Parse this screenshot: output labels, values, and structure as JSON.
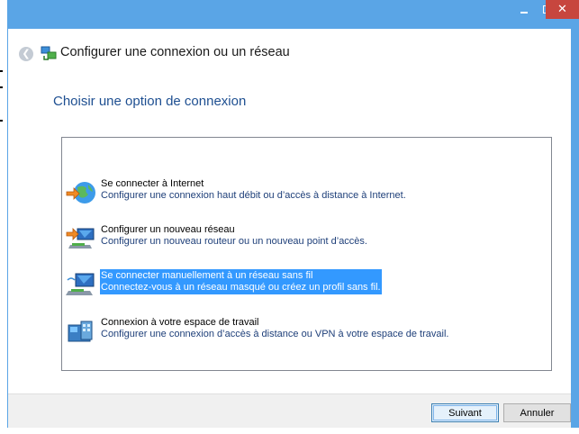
{
  "window": {
    "title": "Configurer une connexion ou un réseau",
    "controls": {
      "minimize_icon": "minimize-icon",
      "maximize_icon": "maximize-icon",
      "close_label": "✕"
    }
  },
  "page": {
    "heading": "Choisir une option de connexion"
  },
  "options": [
    {
      "title": "Se connecter à Internet",
      "description": "Configurer une connexion haut débit ou d’accès à distance à Internet.",
      "icon": "globe-internet-icon",
      "selected": false
    },
    {
      "title": "Configurer un nouveau réseau",
      "description": "Configurer un nouveau routeur ou un nouveau point d’accès.",
      "icon": "new-network-icon",
      "selected": false
    },
    {
      "title": "Se connecter manuellement à un réseau sans fil",
      "description": "Connectez-vous à un réseau masqué ou créez un profil sans fil.",
      "icon": "wireless-network-icon",
      "selected": true
    },
    {
      "title": "Connexion à votre espace de travail",
      "description": "Configurer une connexion d’accès à distance ou VPN à votre espace de travail.",
      "icon": "workplace-vpn-icon",
      "selected": false
    }
  ],
  "footer": {
    "next_label": "Suivant",
    "cancel_label": "Annuler"
  },
  "colors": {
    "title_bar": "#5aa5e6",
    "close_button": "#c7463e",
    "heading": "#1e4f91",
    "selection": "#3399ff"
  }
}
